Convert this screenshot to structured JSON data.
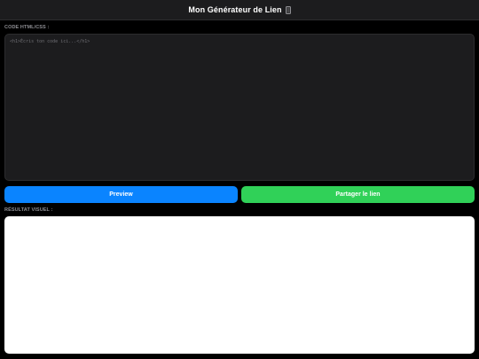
{
  "header": {
    "title": "Mon Générateur de Lien",
    "icon": "phone-icon"
  },
  "editor": {
    "label": "CODE HTML/CSS :",
    "placeholder": "<h1>Écris ton code ici...</h1>",
    "value": ""
  },
  "buttons": {
    "preview_label": "Preview",
    "share_label": "Partager le lien"
  },
  "result": {
    "label": "RÉSULTAT VISUEL :"
  },
  "colors": {
    "background": "#000000",
    "header_bg": "#1c1c1e",
    "editor_bg": "#1c1c1e",
    "preview_button": "#0a84ff",
    "share_button": "#30d158",
    "result_bg": "#ffffff",
    "label_text": "#8e8e93"
  }
}
